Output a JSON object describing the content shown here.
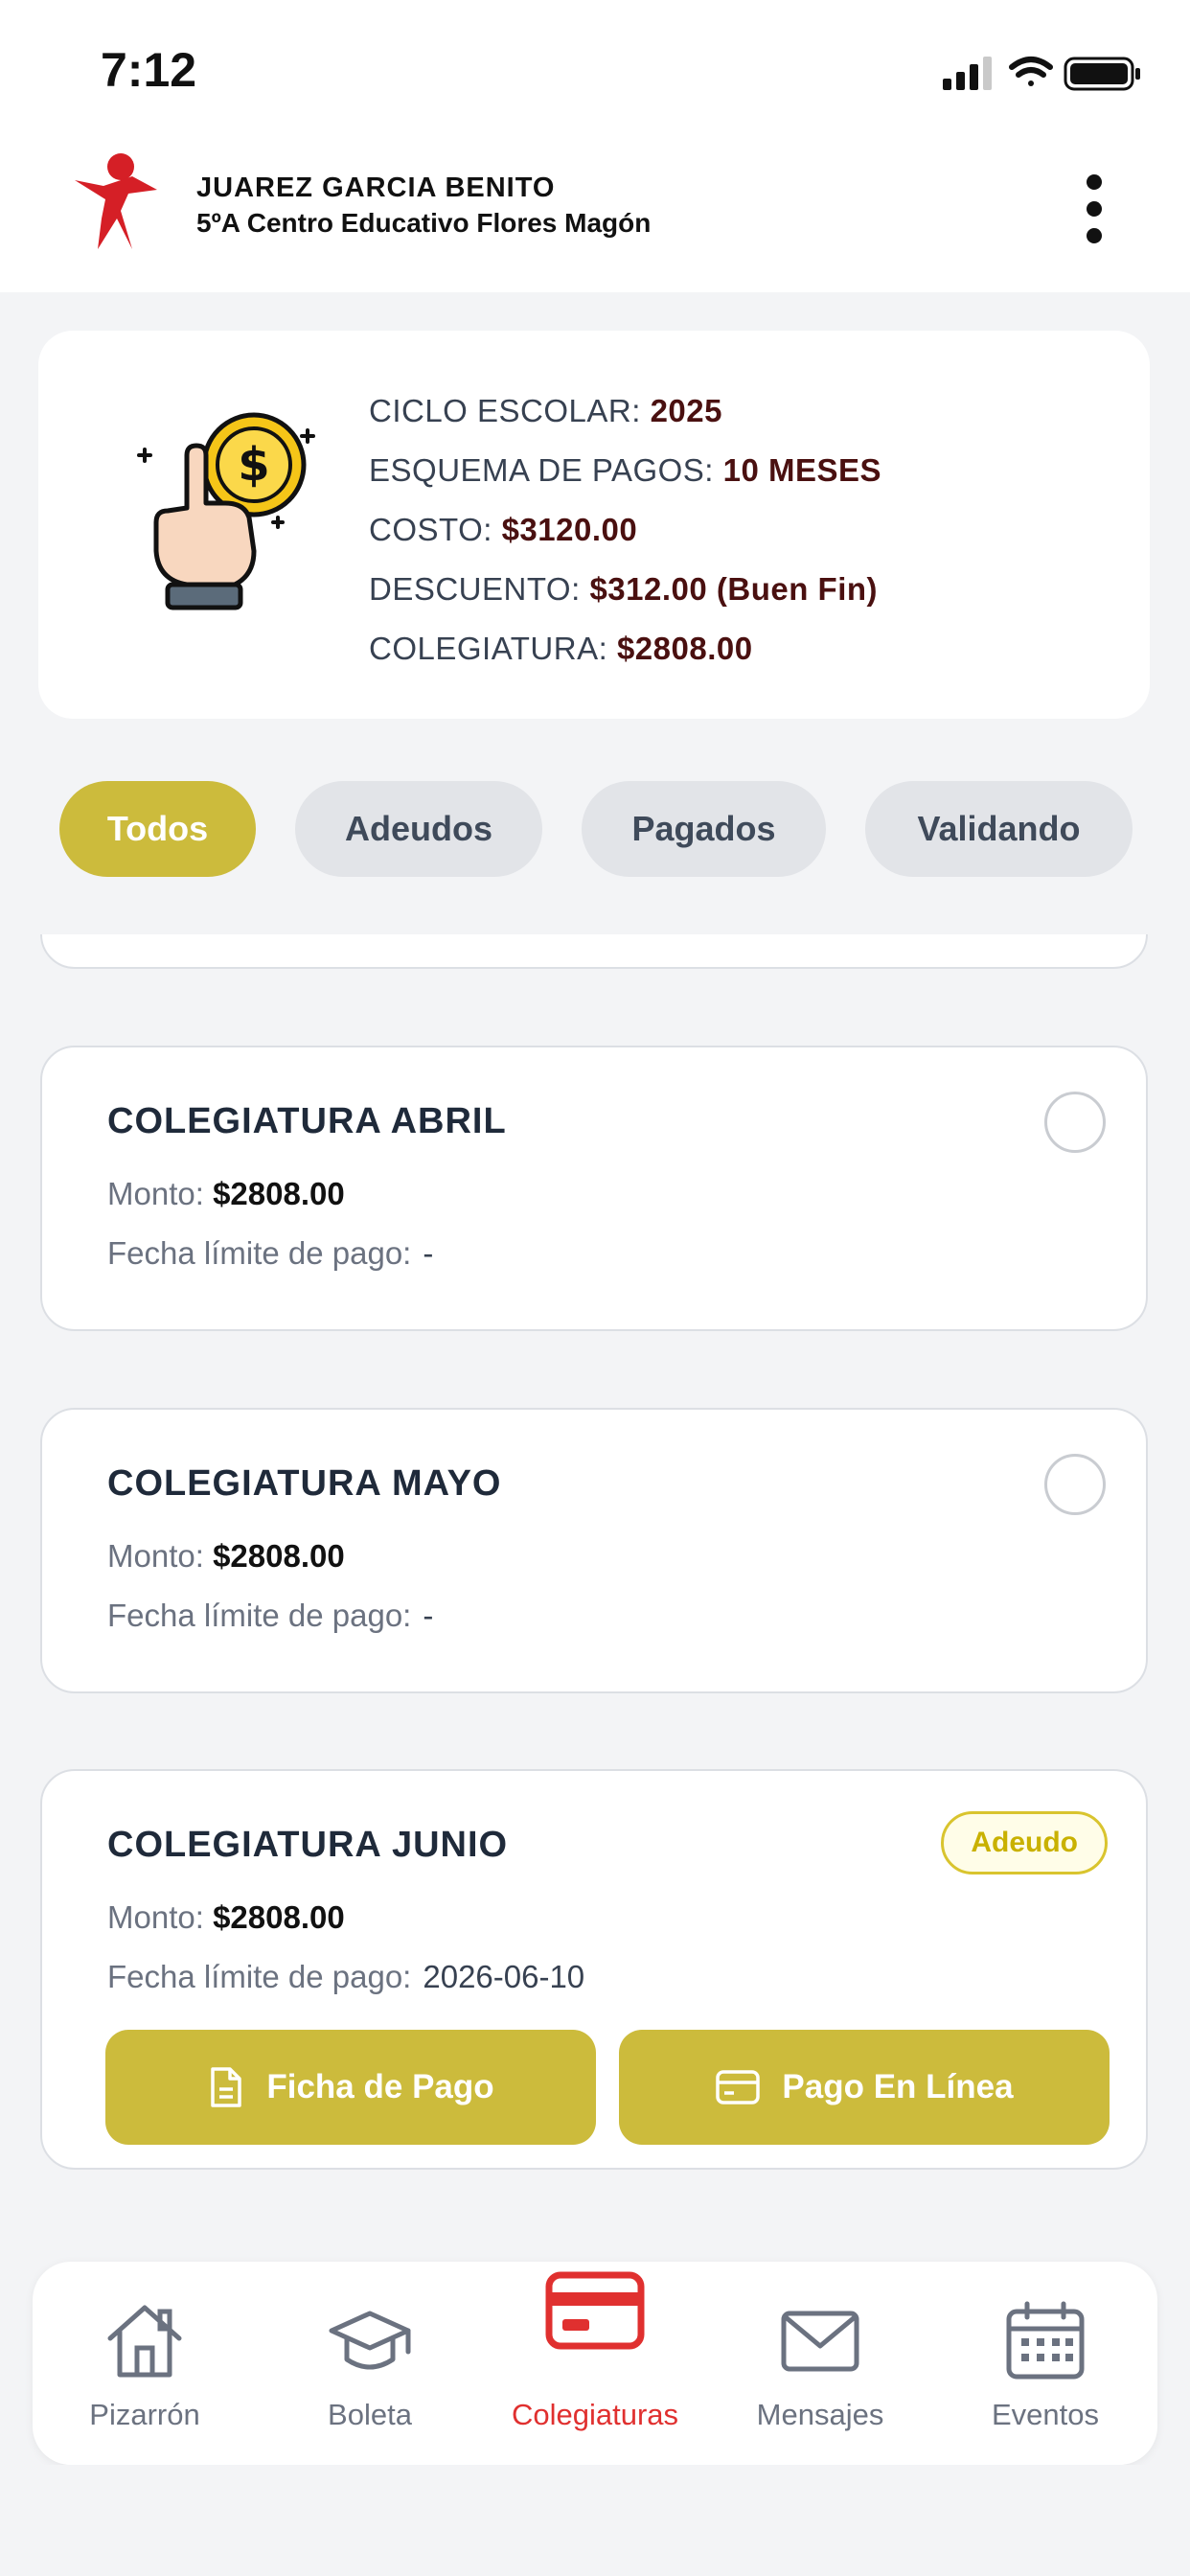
{
  "status_bar": {
    "time": "7:12"
  },
  "header": {
    "student_name": "JUAREZ GARCIA BENITO",
    "school": "5ºA  Centro Educativo Flores Magón",
    "menu_icon": "kebab-menu-icon"
  },
  "summary": {
    "icon": "coin-tap-icon",
    "lines": [
      {
        "label": "CICLO ESCOLAR: ",
        "value": "2025"
      },
      {
        "label": "ESQUEMA DE PAGOS: ",
        "value": "10 MESES"
      },
      {
        "label": "COSTO: ",
        "value": "$3120.00"
      },
      {
        "label": "DESCUENTO: ",
        "value": "$312.00 (Buen Fin)"
      },
      {
        "label": "COLEGIATURA: ",
        "value": "$2808.00"
      }
    ]
  },
  "filters": [
    {
      "label": "Todos",
      "active": true
    },
    {
      "label": "Adeudos",
      "active": false
    },
    {
      "label": "Pagados",
      "active": false
    },
    {
      "label": "Validando",
      "active": false
    }
  ],
  "payments": [
    {
      "title": "COLEGIATURA ABRIL",
      "monto_label": "Monto:",
      "monto": "$2808.00",
      "fecha_label": "Fecha límite de pago:",
      "fecha": "-"
    },
    {
      "title": "COLEGIATURA MAYO",
      "monto_label": "Monto:",
      "monto": "$2808.00",
      "fecha_label": "Fecha límite de pago:",
      "fecha": "-"
    },
    {
      "title": "COLEGIATURA JUNIO",
      "monto_label": "Monto:",
      "monto": "$2808.00",
      "fecha_label": "Fecha límite de pago:",
      "fecha": "2026-06-10",
      "badge": "Adeudo",
      "actions": {
        "ficha": "Ficha de Pago",
        "linea": "Pago En Línea"
      }
    }
  ],
  "tabbar": [
    {
      "label": "Pizarrón",
      "icon": "home-icon",
      "active": false
    },
    {
      "label": "Boleta",
      "icon": "graduation-cap-icon",
      "active": false
    },
    {
      "label": "Colegiaturas",
      "icon": "credit-card-icon",
      "active": true
    },
    {
      "label": "Mensajes",
      "icon": "mail-icon",
      "active": false
    },
    {
      "label": "Eventos",
      "icon": "calendar-icon",
      "active": false
    }
  ],
  "colors": {
    "accent": "#ccbb3c",
    "active_tab": "#e0302f",
    "value_text": "#4a1010",
    "badge_border": "#d9c42e"
  }
}
